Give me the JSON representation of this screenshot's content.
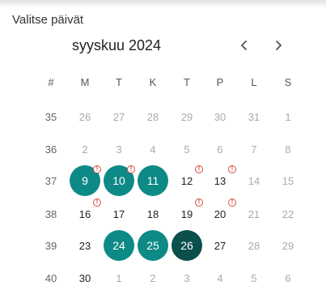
{
  "title": "Valitse päivät",
  "calendar": {
    "month_label": "syyskuu 2024",
    "prev_icon": "chevron-left-icon",
    "next_icon": "chevron-right-icon",
    "header": [
      "#",
      "M",
      "T",
      "K",
      "T",
      "P",
      "L",
      "S"
    ],
    "weeks": [
      {
        "week": "35",
        "days": [
          {
            "d": "26",
            "state": "other"
          },
          {
            "d": "27",
            "state": "other"
          },
          {
            "d": "28",
            "state": "other"
          },
          {
            "d": "29",
            "state": "other"
          },
          {
            "d": "30",
            "state": "other"
          },
          {
            "d": "31",
            "state": "other"
          },
          {
            "d": "1",
            "state": "weekend"
          }
        ]
      },
      {
        "week": "36",
        "days": [
          {
            "d": "2",
            "state": "disabled"
          },
          {
            "d": "3",
            "state": "disabled"
          },
          {
            "d": "4",
            "state": "disabled"
          },
          {
            "d": "5",
            "state": "disabled"
          },
          {
            "d": "6",
            "state": "disabled"
          },
          {
            "d": "7",
            "state": "weekend"
          },
          {
            "d": "8",
            "state": "weekend"
          }
        ]
      },
      {
        "week": "37",
        "days": [
          {
            "d": "9",
            "state": "selected",
            "warning": true
          },
          {
            "d": "10",
            "state": "selected",
            "warning": true
          },
          {
            "d": "11",
            "state": "selected"
          },
          {
            "d": "12",
            "state": "normal",
            "warning": true
          },
          {
            "d": "13",
            "state": "normal",
            "warning": true
          },
          {
            "d": "14",
            "state": "weekend"
          },
          {
            "d": "15",
            "state": "weekend"
          }
        ]
      },
      {
        "week": "38",
        "days": [
          {
            "d": "16",
            "state": "normal",
            "warning": true
          },
          {
            "d": "17",
            "state": "normal"
          },
          {
            "d": "18",
            "state": "normal"
          },
          {
            "d": "19",
            "state": "normal",
            "warning": true
          },
          {
            "d": "20",
            "state": "normal",
            "warning": true
          },
          {
            "d": "21",
            "state": "weekend"
          },
          {
            "d": "22",
            "state": "weekend"
          }
        ]
      },
      {
        "week": "39",
        "days": [
          {
            "d": "23",
            "state": "normal"
          },
          {
            "d": "24",
            "state": "selected"
          },
          {
            "d": "25",
            "state": "selected"
          },
          {
            "d": "26",
            "state": "current"
          },
          {
            "d": "27",
            "state": "normal"
          },
          {
            "d": "28",
            "state": "weekend"
          },
          {
            "d": "29",
            "state": "weekend"
          }
        ]
      },
      {
        "week": "40",
        "days": [
          {
            "d": "30",
            "state": "normal"
          },
          {
            "d": "1",
            "state": "other"
          },
          {
            "d": "2",
            "state": "other"
          },
          {
            "d": "3",
            "state": "other"
          },
          {
            "d": "4",
            "state": "other"
          },
          {
            "d": "5",
            "state": "other"
          },
          {
            "d": "6",
            "state": "other"
          }
        ]
      }
    ]
  },
  "colors": {
    "selected": "#0e8a86",
    "current": "#0b4f4b",
    "warning": "#d94b45"
  }
}
